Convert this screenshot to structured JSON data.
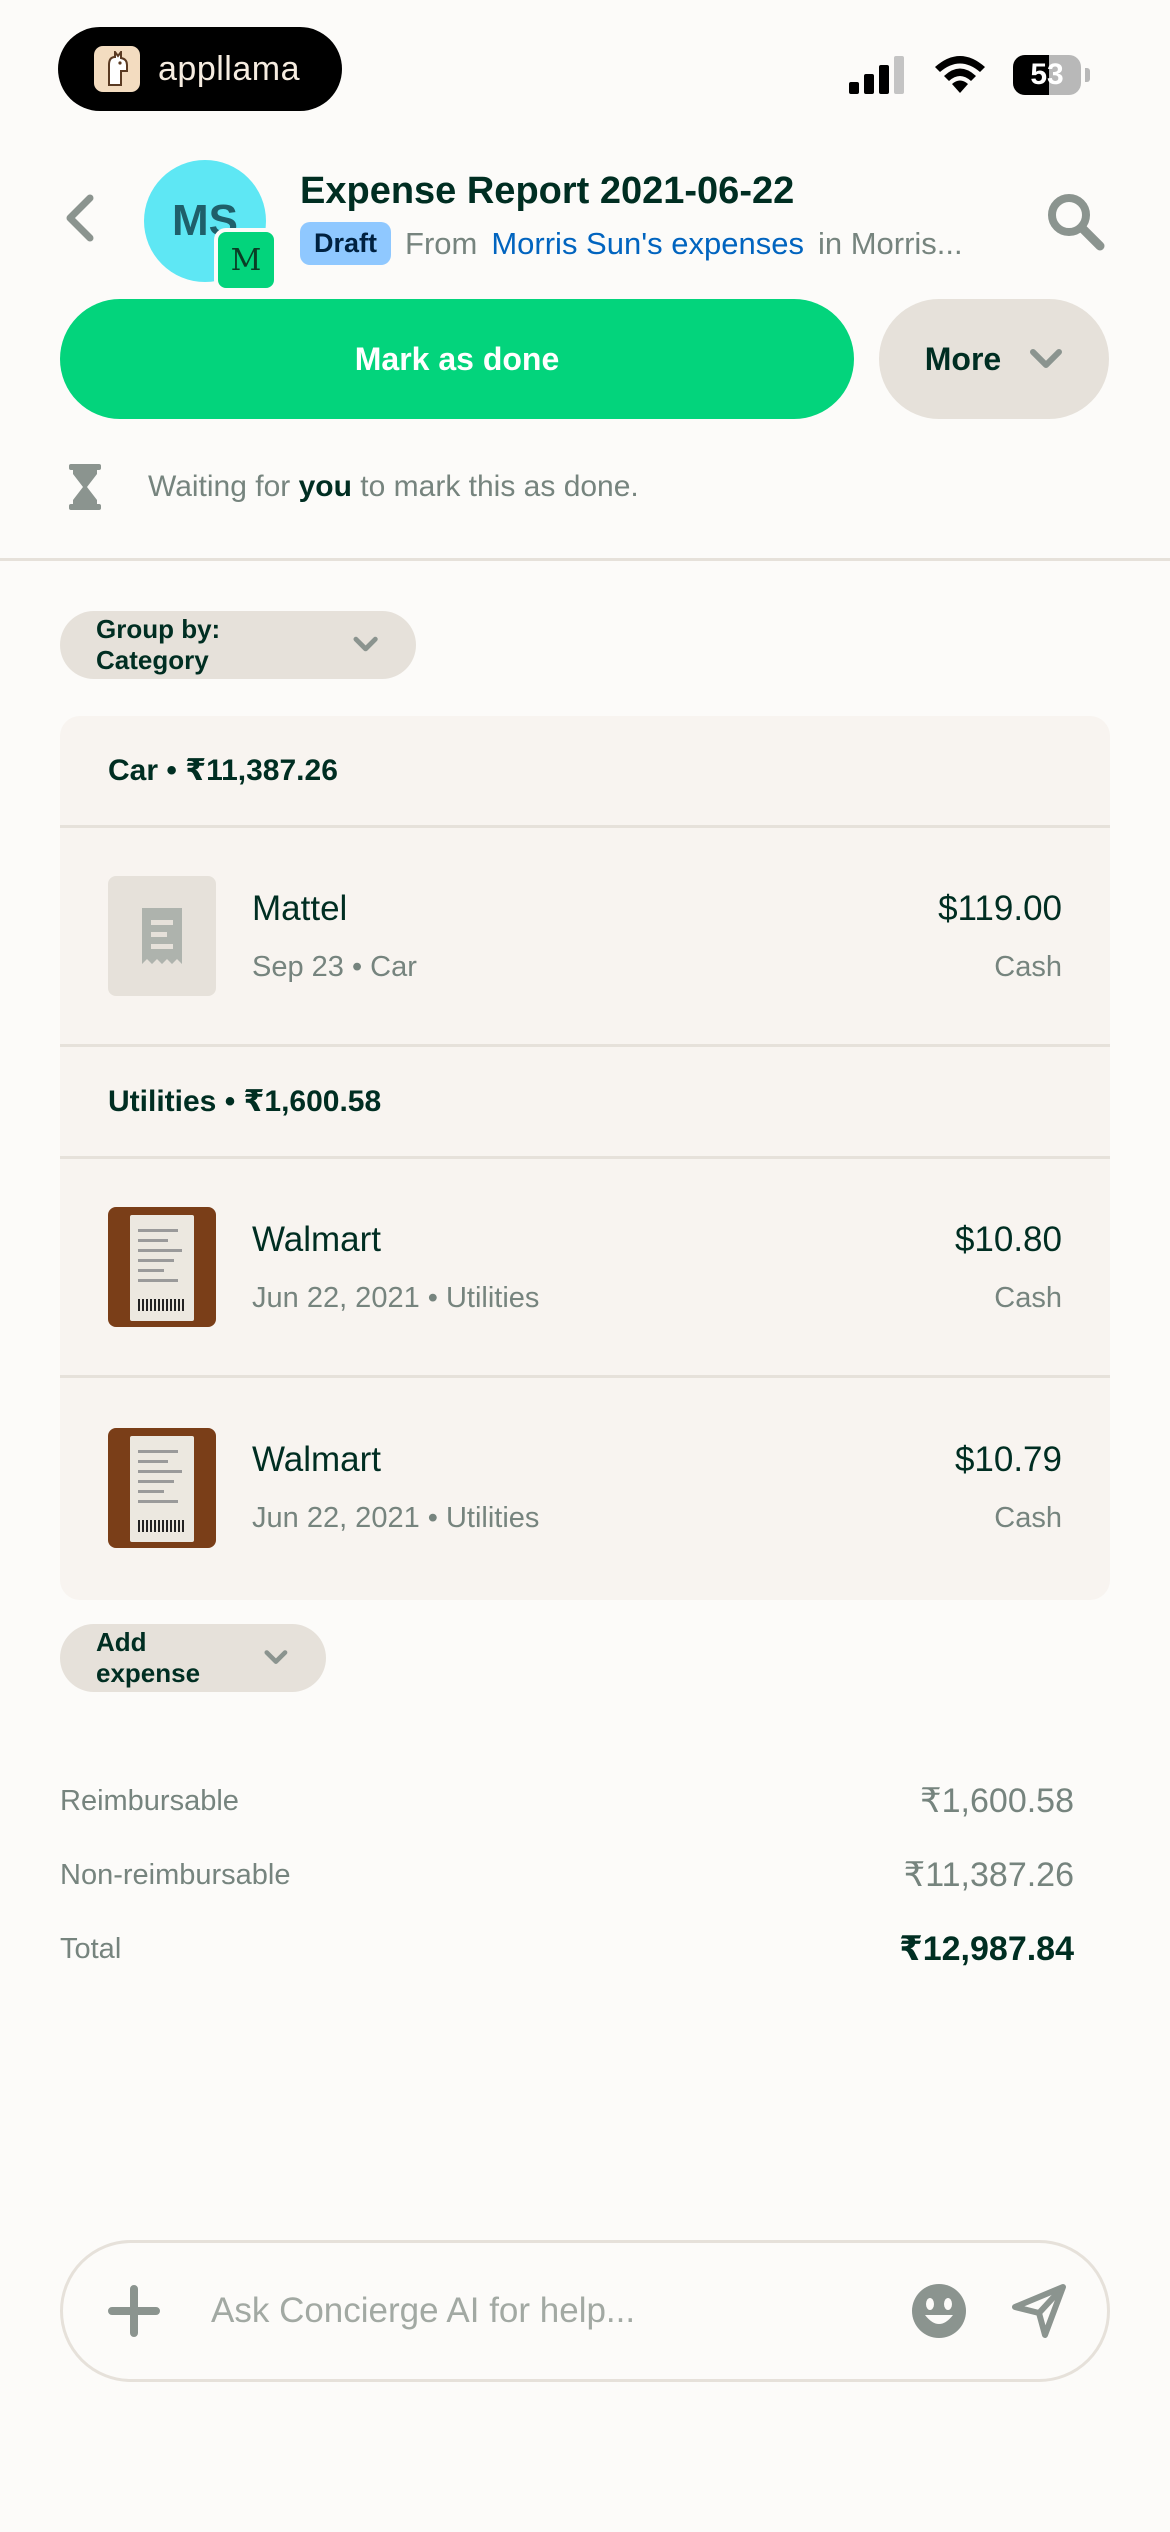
{
  "status_bar": {
    "brand": "appllama",
    "battery": "53",
    "battery_level": 0.53
  },
  "header": {
    "avatar_initials": "MS",
    "workspace_initial": "M",
    "title": "Expense Report 2021-06-22",
    "status_badge": "Draft",
    "from_prefix": "From",
    "from_link": "Morris Sun's expenses",
    "from_suffix": "in Morris..."
  },
  "actions": {
    "mark_done": "Mark as done",
    "more": "More"
  },
  "waiting": {
    "prefix": "Waiting for",
    "who": "you",
    "suffix": "to mark this as done."
  },
  "group_by": "Group by: Category",
  "sections": [
    {
      "title": "Car • ₹11,387.26",
      "items": [
        {
          "merchant": "Mattel",
          "meta": "Sep 23 • Car",
          "amount": "$119.00",
          "payment": "Cash",
          "thumb": "receipt-placeholder-icon"
        }
      ]
    },
    {
      "title": "Utilities • ₹1,600.58",
      "items": [
        {
          "merchant": "Walmart",
          "meta": "Jun 22, 2021 • Utilities",
          "amount": "$10.80",
          "payment": "Cash",
          "thumb": "receipt-photo"
        },
        {
          "merchant": "Walmart",
          "meta": "Jun 22, 2021 • Utilities",
          "amount": "$10.79",
          "payment": "Cash",
          "thumb": "receipt-photo"
        }
      ]
    }
  ],
  "add_expense": "Add expense",
  "totals": {
    "reimbursable_label": "Reimbursable",
    "reimbursable_value": "₹1,600.58",
    "non_reimbursable_label": "Non-reimbursable",
    "non_reimbursable_value": "₹11,387.26",
    "total_label": "Total",
    "total_value": "₹12,987.84"
  },
  "composer": {
    "placeholder": "Ask Concierge AI for help..."
  },
  "colors": {
    "accent_green": "#03d47c",
    "text_dark": "#002e22",
    "text_muted": "#76847e",
    "link_blue": "#0164bf",
    "draft_badge": "#8fc8ff",
    "avatar_cyan": "#5ee7f4"
  }
}
